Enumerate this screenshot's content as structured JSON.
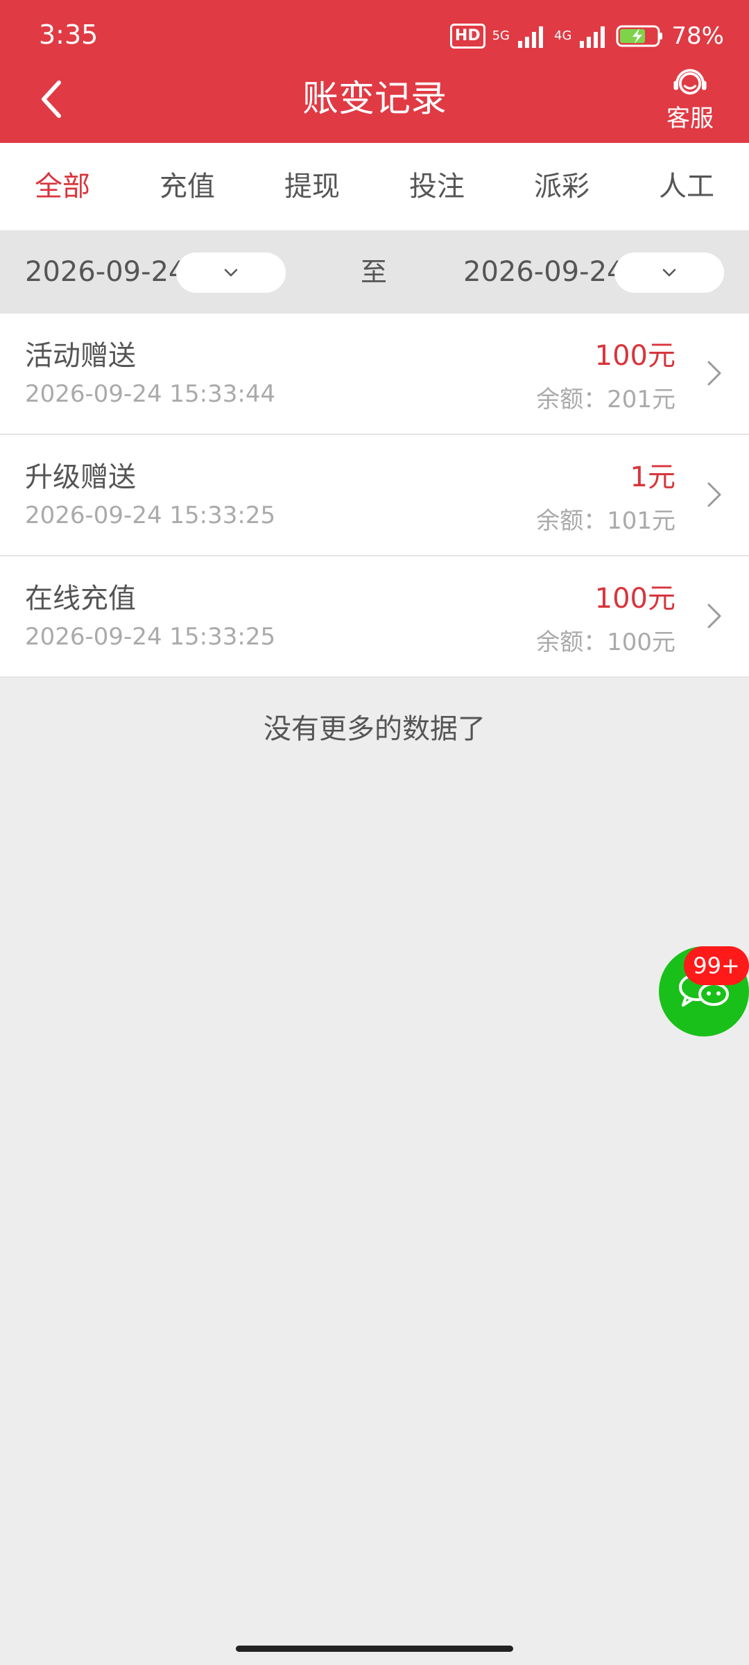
{
  "status": {
    "time": "3:35",
    "hd": "HD",
    "net1": "5G",
    "net2": "4G",
    "battery": "78%"
  },
  "header": {
    "title": "账变记录",
    "service_label": "客服"
  },
  "tabs": [
    {
      "label": "全部"
    },
    {
      "label": "充值"
    },
    {
      "label": "提现"
    },
    {
      "label": "投注"
    },
    {
      "label": "派彩"
    },
    {
      "label": "人工"
    }
  ],
  "active_tab": "全部",
  "filter": {
    "start_date": "2026-09-24",
    "end_date": "2026-09-24",
    "to_label": "至"
  },
  "records": [
    {
      "title": "活动赠送",
      "time": "2026-09-24 15:33:44",
      "amount": "100元",
      "balance": "余额：201元"
    },
    {
      "title": "升级赠送",
      "time": "2026-09-24 15:33:25",
      "amount": "1元",
      "balance": "余额：101元"
    },
    {
      "title": "在线充值",
      "time": "2026-09-24 15:33:25",
      "amount": "100元",
      "balance": "余额：100元"
    }
  ],
  "no_more_text": "没有更多的数据了",
  "chat": {
    "badge": "99+"
  },
  "colors": {
    "header": "#e03a44",
    "accent": "#d8353c",
    "chat": "#19c01a",
    "badge": "#ff1a1a"
  }
}
